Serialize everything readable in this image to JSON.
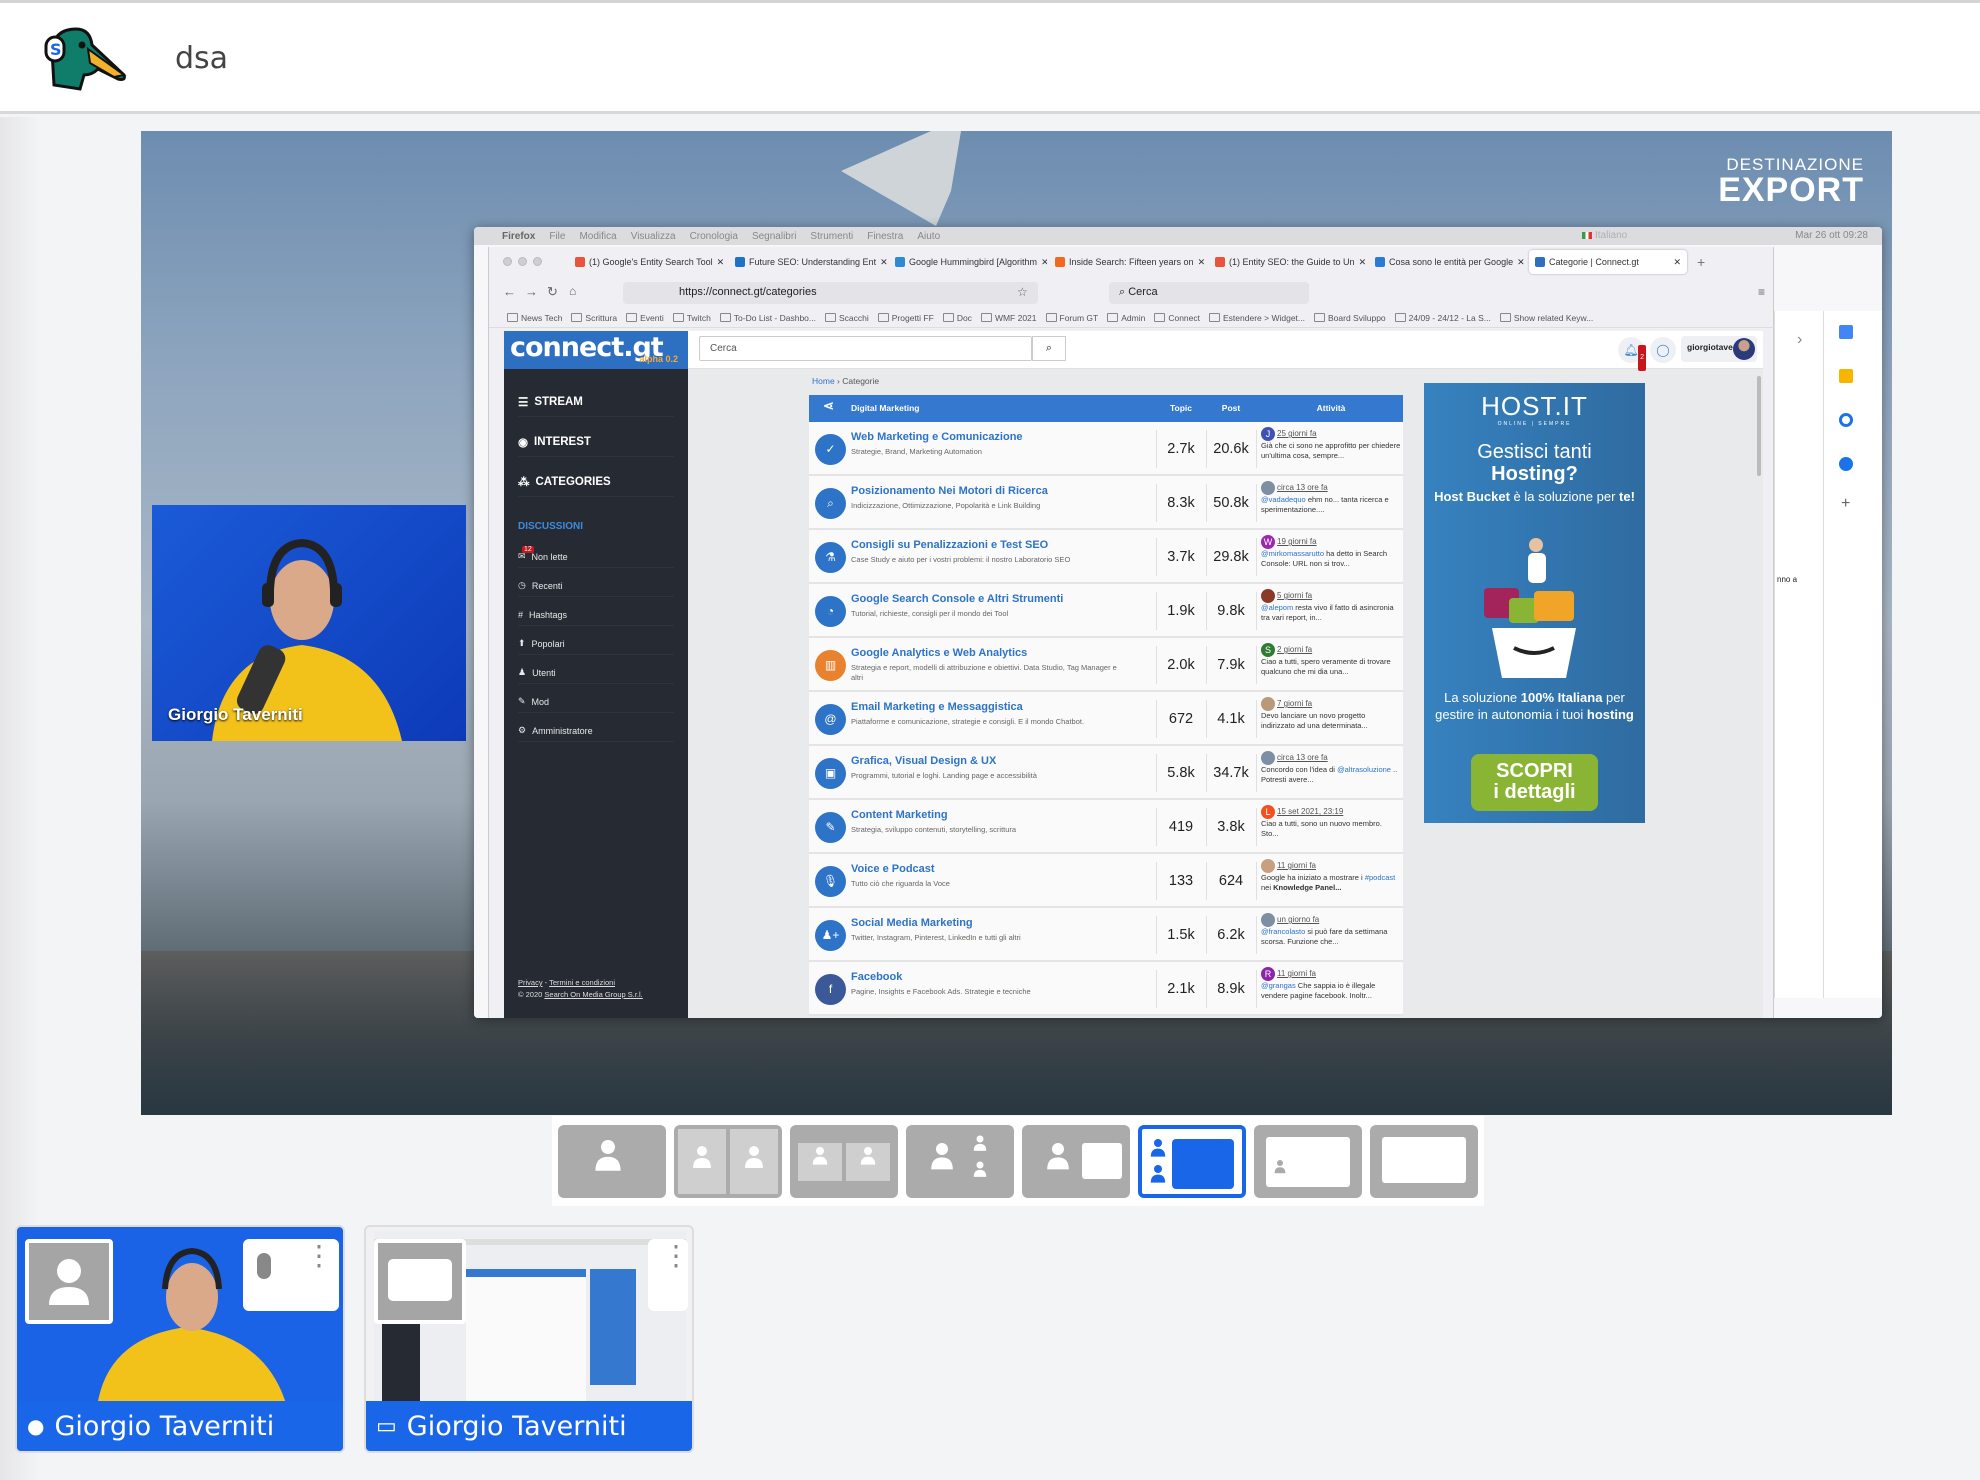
{
  "app": {
    "title": "dsa",
    "logo": "duck-headphones-logo"
  },
  "stage": {
    "brand_line1": "DESTINAZIONE",
    "brand_line2": "EXPORT",
    "webcam_name": "Giorgio Taverniti"
  },
  "browser": {
    "menu": [
      "Firefox",
      "File",
      "Modifica",
      "Visualizza",
      "Cronologia",
      "Segnalibri",
      "Strumenti",
      "Finestra",
      "Aiuto"
    ],
    "clock": "Mar 26 ott 09:28",
    "keyboard": "Italiano",
    "tabs": [
      {
        "label": "(1) Google's Entity Search Tool",
        "color": "#e8543a"
      },
      {
        "label": "Future SEO: Understanding Ent",
        "color": "#1e73c8"
      },
      {
        "label": "Google Hummingbird [Algorithm",
        "color": "#2d8bd4"
      },
      {
        "label": "Inside Search: Fifteen years on",
        "color": "#f06a1e"
      },
      {
        "label": "(1) Entity SEO: the Guide to Un",
        "color": "#e8543a"
      },
      {
        "label": "Cosa sono le entità per Google",
        "color": "#2a7bd8"
      },
      {
        "label": "Categorie | Connect.gt",
        "color": "#2d6fc0",
        "active": true
      }
    ],
    "url": "https://connect.gt/categories",
    "search_placeholder": "Cerca",
    "bookmarks": [
      "News Tech",
      "Scrittura",
      "Eventi",
      "Twitch",
      "To-Do List - Dashbo...",
      "Scacchi",
      "Progetti FF",
      "Doc",
      "WMF 2021",
      "Forum GT",
      "Admin",
      "Connect",
      "Estendere > Widget...",
      "Board Sviluppo",
      "24/09 - 24/12 - La S...",
      "Show related Keyw..."
    ],
    "right_panel_text": "nno a"
  },
  "site": {
    "logo": "connect.gt",
    "logo_version": "alpha 0.2",
    "search_placeholder": "Cerca",
    "notifications": "2",
    "username": "giorgiotave",
    "sidebar": {
      "main": [
        "STREAM",
        "INTEREST",
        "CATEGORIES"
      ],
      "section": "DISCUSSIONI",
      "unread_badge": "12",
      "items": [
        "Non lette",
        "Recenti",
        "Hashtags",
        "Popolari",
        "Utenti",
        "Mod",
        "Amministratore"
      ],
      "footer_privacy": "Privacy",
      "footer_sep": " - ",
      "footer_terms": "Termini e condizioni",
      "footer_copy": "© 2020 ",
      "footer_company": "Search On Media Group S.r.l."
    },
    "breadcrumb": {
      "home": "Home",
      "sep": " › ",
      "current": "Categorie"
    },
    "table": {
      "title": "Digital Marketing",
      "col_topic": "Topic",
      "col_post": "Post",
      "col_activity": "Attività",
      "rows": [
        {
          "title": "Web Marketing e Comunicazione",
          "desc": "Strategie, Brand, Marketing Automation",
          "topic": "2.7k",
          "post": "20.6k",
          "icon": "check-circle-icon",
          "icon_color": "#2d73c8",
          "avatar": "J",
          "avatar_color": "#3f51b5",
          "time": "25 giorni fa",
          "mention": "",
          "text": "Già che ci sono ne approfitto per chiedere un'ultima cosa, sempre..."
        },
        {
          "title": "Posizionamento Nei Motori di Ricerca",
          "desc": "Indicizzazione, Ottimizzazione, Popolarità e Link Building",
          "topic": "8.3k",
          "post": "50.8k",
          "icon": "search-icon",
          "icon_color": "#2d73c8",
          "avatar": "",
          "avatar_color": "#7d8fa3",
          "time": "circa 13 ore fa",
          "mention": "@vadadequo",
          "text": " ehm no... tanta ricerca e sperimentazione...."
        },
        {
          "title": "Consigli su Penalizzazioni e Test SEO",
          "desc": "Case Study e aiuto per i vostri problemi: il nostro Laboratorio SEO",
          "topic": "3.7k",
          "post": "29.8k",
          "icon": "flask-icon",
          "icon_color": "#2d73c8",
          "avatar": "W",
          "avatar_color": "#9c27b0",
          "time": "19 giorni fa",
          "mention": "@mirkomassarutto",
          "text": " ha detto in Search Console: URL non si trov..."
        },
        {
          "title": "Google Search Console e Altri Strumenti",
          "desc": "Tutorial, richieste, consigli per il mondo dei Tool",
          "topic": "1.9k",
          "post": "9.8k",
          "icon": "dashboard-icon",
          "icon_color": "#2d73c8",
          "avatar": "",
          "avatar_color": "#8b3a2a",
          "time": "5 giorni fa",
          "mention": "@alepom",
          "text": " resta vivo il fatto di asincronia tra vari report, in..."
        },
        {
          "title": "Google Analytics e Web Analytics",
          "desc": "Strategia e report, modelli di attribuzione e obiettivi. Data Studio, Tag Manager e altri",
          "topic": "2.0k",
          "post": "7.9k",
          "icon": "bar-chart-icon",
          "icon_color": "#e8822e",
          "avatar": "S",
          "avatar_color": "#2e7d32",
          "time": "2 giorni fa",
          "mention": "",
          "text": "Ciao a tutti, spero veramente di trovare qualcuno che mi dia una..."
        },
        {
          "title": "Email Marketing e Messaggistica",
          "desc": "Piattaforme e comunicazione, strategie e consigli. E il mondo Chatbot.",
          "topic": "672",
          "post": "4.1k",
          "icon": "at-icon",
          "icon_color": "#2d73c8",
          "avatar": "",
          "avatar_color": "#b89a7a",
          "time": "7 giorni fa",
          "mention": "",
          "text": "Devo lanciare un novo progetto indirizzato ad una determinata..."
        },
        {
          "title": "Grafica, Visual Design & UX",
          "desc": "Programmi, tutorial e loghi. Landing page e accessibilità",
          "topic": "5.8k",
          "post": "34.7k",
          "icon": "image-icon",
          "icon_color": "#2d73c8",
          "avatar": "",
          "avatar_color": "#7d8fa3",
          "time": "circa 13 ore fa",
          "mention": "@altrasoluzione",
          "text_before": "Concordo con l'idea di ",
          "text": " .. Potresti avere..."
        },
        {
          "title": "Content Marketing",
          "desc": "Strategia, sviluppo contenuti, storytelling, scrittura",
          "topic": "419",
          "post": "3.8k",
          "icon": "edit-icon",
          "icon_color": "#2d73c8",
          "avatar": "L",
          "avatar_color": "#f4511e",
          "time": "15 set 2021, 23:19",
          "mention": "",
          "text": "Ciao a tutti, sono un nuovo membro. Sto..."
        },
        {
          "title": "Voice e Podcast",
          "desc": "Tutto ciò che riguarda la Voce",
          "topic": "133",
          "post": "624",
          "icon": "microphone-icon",
          "icon_color": "#2d73c8",
          "avatar": "",
          "avatar_color": "#c8a080",
          "time": "11 giorni fa",
          "mention": "#podcast",
          "text_before": "Google ha iniziato a mostrare i ",
          "text": " nei ",
          "bold": "Knowledge Panel..."
        },
        {
          "title": "Social Media Marketing",
          "desc": "Twitter, Instagram, Pinterest, LinkedIn e tutti gli altri",
          "topic": "1.5k",
          "post": "6.2k",
          "icon": "user-plus-icon",
          "icon_color": "#2d73c8",
          "avatar": "",
          "avatar_color": "#7d8fa3",
          "time": "un giorno fa",
          "mention": "@francolasto",
          "text": " si può fare da settimana scorsa. Funzione che..."
        },
        {
          "title": "Facebook",
          "desc": "Pagine, Insights e Facebook Ads. Strategie e tecniche",
          "topic": "2.1k",
          "post": "8.9k",
          "icon": "facebook-icon",
          "icon_color": "#3b5998",
          "avatar": "R",
          "avatar_color": "#8e24aa",
          "time": "11 giorni fa",
          "mention": "@grangas",
          "text": " Che sappia io è illegale vendere pagine facebook. Inoltr..."
        }
      ]
    },
    "ad": {
      "logo": "HOST.IT",
      "slogan": "ONLINE | SEMPRE",
      "headline1": "Gestisci tanti",
      "headline2": "Hosting?",
      "sub_bold": "Host Bucket",
      "sub_rest": " è la soluzione per ",
      "sub_bold2": "te!",
      "body1": "La soluzione ",
      "body_bold": "100% Italiana",
      "body2": " per gestire in autonomia i tuoi ",
      "body_bold2": "hosting",
      "cta1": "SCOPRI",
      "cta2": "i dettagli"
    }
  },
  "layouts": {
    "options": [
      "single-speaker",
      "two-columns",
      "two-boxes",
      "speaker-plus-two",
      "speaker-plus-screen",
      "people-plus-screen",
      "screen-with-pip",
      "screen-only"
    ],
    "selected": 5,
    "accent": "#1a66e8"
  },
  "tiles": [
    {
      "name": "Giorgio Taverniti",
      "type": "camera",
      "icon": "person-icon"
    },
    {
      "name": "Giorgio Taverniti",
      "type": "screen",
      "icon": "monitor-icon"
    }
  ]
}
